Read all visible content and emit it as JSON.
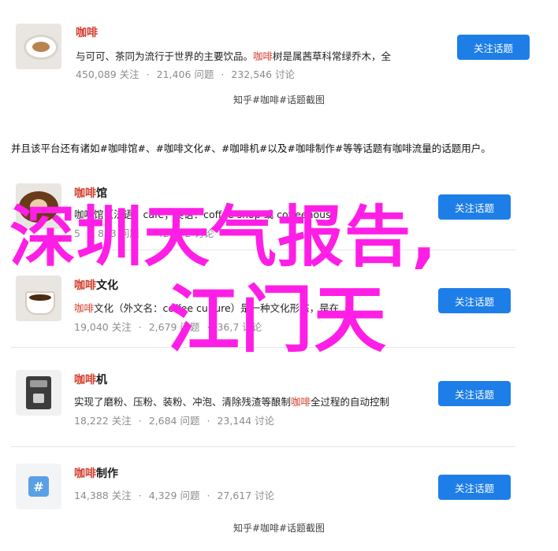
{
  "follow_label": "关注话题",
  "top_card": {
    "title": "咖啡",
    "desc_pre": "与可可、茶同为流行于世界的主要饮品。",
    "desc_hl": "咖啡",
    "desc_post": "树是属茜草科常绿乔木，全",
    "stats": [
      "450,089 关注",
      "21,406 问题",
      "232,546 讨论"
    ],
    "caption": "知乎#咖啡#话题截图"
  },
  "intro": "并且该平台还有诸如#咖啡馆#、#咖啡文化#、#咖啡机#以及#咖啡制作#等等话题有咖啡流量的话题用户。",
  "list": [
    {
      "title_hl": "咖啡",
      "title_rest": "馆",
      "desc": "咖啡馆（法语：café；英语：coffee shop 或 coffeehouse",
      "stats": [
        "",
        "",
        ""
      ],
      "stats_visible": [
        "5",
        "813 问题",
        "42,972 讨论"
      ],
      "icon": "coffee-cup-thumbnail"
    },
    {
      "title_hl": "咖啡",
      "title_rest": "文化",
      "desc_hl": "咖啡",
      "desc": "文化（外文名：coffee culture）是一种文化形态，是在",
      "stats_visible": [
        "19,040 关注",
        "2,679 问题",
        "36,7 讨论"
      ],
      "icon": "latte-thumbnail"
    },
    {
      "title_hl": "咖啡",
      "title_rest": "机",
      "desc": "实现了磨粉、压粉、装粉、冲泡、清除残渣等酿制",
      "desc_hl": "咖啡",
      "desc_post": "全过程的自动控制",
      "stats_visible": [
        "18,222 关注",
        "2,684 问题",
        "23,144 讨论"
      ],
      "icon": "coffee-machine-thumbnail"
    },
    {
      "title_hl": "咖啡",
      "title_rest": "制作",
      "stats_visible": [
        "14,388 关注",
        "4,329 问题",
        "27,617 讨论"
      ],
      "icon": "hash-topic-thumbnail"
    }
  ],
  "bottom_caption": "知乎#咖啡#话题截图",
  "overlay": {
    "line1": "深圳天气报告,",
    "line2": "江门天",
    "color": "#ff1ee6"
  },
  "colors": {
    "accent": "#d33c2b",
    "button": "#1e7ee8"
  }
}
